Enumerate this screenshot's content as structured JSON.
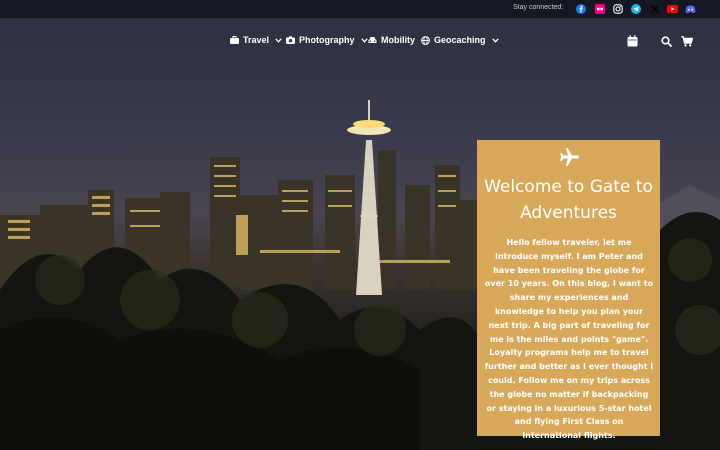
{
  "topbar": {
    "stay_connected": "Stay connected:",
    "social": [
      {
        "icon": "facebook-icon",
        "color": "#1877f2"
      },
      {
        "icon": "flickr-icon",
        "color": "#ff0084"
      },
      {
        "icon": "instagram-icon",
        "color": "#ffffff"
      },
      {
        "icon": "telegram-icon",
        "color": "#2aabee"
      },
      {
        "icon": "x-icon",
        "color": "#000000"
      },
      {
        "icon": "youtube-icon",
        "color": "#ff0000"
      },
      {
        "icon": "discord-icon",
        "color": "#5865f2"
      }
    ]
  },
  "nav": {
    "items": [
      {
        "label": "Travel",
        "icon": "suitcase-icon",
        "has_dropdown": true
      },
      {
        "label": "Photography",
        "icon": "camera-icon",
        "has_dropdown": true
      },
      {
        "label": "Mobility",
        "icon": "car-icon",
        "has_dropdown": false
      },
      {
        "label": "Geocaching",
        "icon": "globe-icon",
        "has_dropdown": true
      }
    ],
    "right_icons": [
      "calendar-icon",
      "search-icon",
      "cart-icon"
    ]
  },
  "hero": {
    "card_color": "#d8a95b",
    "card_icon": "airplane-icon",
    "title": "Welcome to Gate to Adventures",
    "text": "Hello fellow traveler, let me introduce myself. I am Peter and have been traveling the globe for over 10 years. On this blog, I want to share my experiences and knowledge to help you plan your next trip. A big part of traveling for me is the miles and points \"game\". Loyalty programs help me to travel further and better as I ever thought I could. Follow me on my trips across the globe no matter if backpacking or staying in a luxurious 5-star hotel and flying First Class on international flights."
  }
}
